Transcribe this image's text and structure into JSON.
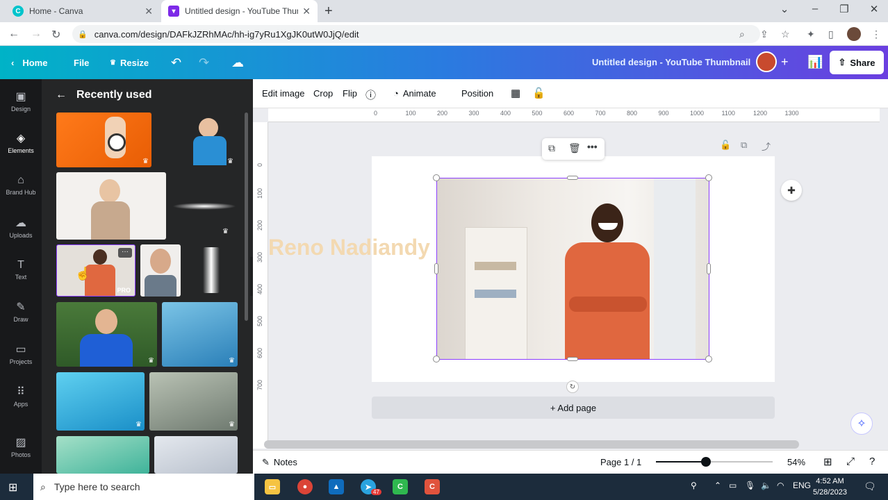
{
  "browser": {
    "tabs": [
      {
        "title": "Home - Canva",
        "active": false
      },
      {
        "title": "Untitled design - YouTube Thumb",
        "active": true
      }
    ],
    "url": "canva.com/design/DAFkJZRhMAc/hh-ig7yRu1XgJK0utW0JjQ/edit"
  },
  "header": {
    "home": "Home",
    "file": "File",
    "resize": "Resize",
    "title": "Untitled design - YouTube Thumbnail",
    "share": "Share"
  },
  "rail": {
    "items": [
      {
        "label": "Design",
        "icon": "design-icon"
      },
      {
        "label": "Elements",
        "icon": "elements-icon"
      },
      {
        "label": "Brand Hub",
        "icon": "brand-hub-icon"
      },
      {
        "label": "Uploads",
        "icon": "uploads-icon"
      },
      {
        "label": "Text",
        "icon": "text-icon"
      },
      {
        "label": "Draw",
        "icon": "draw-icon"
      },
      {
        "label": "Projects",
        "icon": "projects-icon"
      },
      {
        "label": "Apps",
        "icon": "apps-icon"
      },
      {
        "label": "Photos",
        "icon": "photos-icon"
      }
    ]
  },
  "panel": {
    "title": "Recently used",
    "pro_badge": "PRO"
  },
  "context": {
    "edit_image": "Edit image",
    "crop": "Crop",
    "flip": "Flip",
    "animate": "Animate",
    "position": "Position"
  },
  "ruler": {
    "h": [
      "0",
      "100",
      "200",
      "300",
      "400",
      "500",
      "600",
      "700",
      "800",
      "900",
      "1000",
      "1100",
      "1200",
      "1300"
    ],
    "v": [
      "0",
      "100",
      "200",
      "300",
      "400",
      "500",
      "600",
      "700"
    ]
  },
  "canvas": {
    "overlay_text": "Reno Nadiandy",
    "add_page": "+ Add page"
  },
  "bottom": {
    "notes": "Notes",
    "page": "Page 1 / 1",
    "zoom_fraction": 0.43,
    "zoom": "54%"
  },
  "taskbar": {
    "search_placeholder": "Type here to search",
    "lang": "ENG",
    "time": "4:52 AM",
    "date": "5/28/2023",
    "badge": "47"
  },
  "colors": {
    "accent": "#8b3dff",
    "rail_bg": "#18191b",
    "panel_bg": "#252627"
  }
}
